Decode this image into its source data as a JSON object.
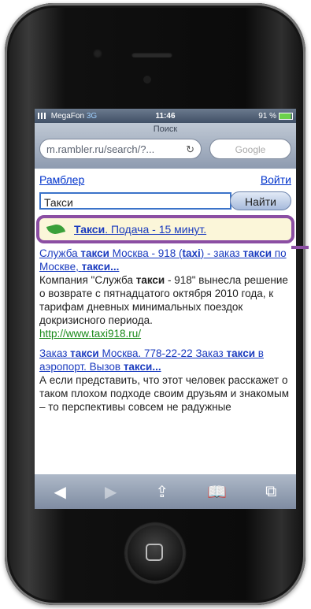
{
  "status": {
    "carrier": "MegaFon",
    "network": "3G",
    "time": "11:46",
    "battery": "91 %"
  },
  "browser": {
    "title": "Поиск",
    "url": "m.rambler.ru/search/?...",
    "search_placeholder": "Google"
  },
  "header": {
    "brand": "Рамблер",
    "login": "Войти"
  },
  "search": {
    "query": "Такси",
    "button": "Найти"
  },
  "ad": {
    "term": "Такси",
    "text": ". Подача - 15 минут."
  },
  "results": [
    {
      "title_parts": [
        "Служба ",
        "такси",
        " Москва - 918 (",
        "taxi",
        ") - заказ ",
        "такси",
        " по Москве, ",
        "такси..."
      ],
      "snippet_parts": [
        "Компания \"Служба ",
        "такси",
        " - 918\" вынесла решение о возврате с пятнадцатого октября 2010 года, к тарифам дневных минимальных поездок докризисного периода."
      ],
      "url": "http://www.taxi918.ru/"
    },
    {
      "title_parts": [
        "Заказ ",
        "такси",
        " Москва. 778-22-22 Заказ ",
        "такси",
        " в аэропорт. Вызов ",
        "такси..."
      ],
      "snippet_parts": [
        "А если представить, что этот человек расскажет о таком плохом подходе своим друзьям и знакомым – то перспективы совсем не радужные"
      ]
    }
  ],
  "toolbar": {
    "back": "◀",
    "forward": "▶",
    "share": "⇪",
    "bookmarks": "📖",
    "tabs": "⧉"
  },
  "colors": {
    "highlight_border": "#8b4ea3",
    "link": "#1a3bbf",
    "url": "#1a8a1a"
  }
}
